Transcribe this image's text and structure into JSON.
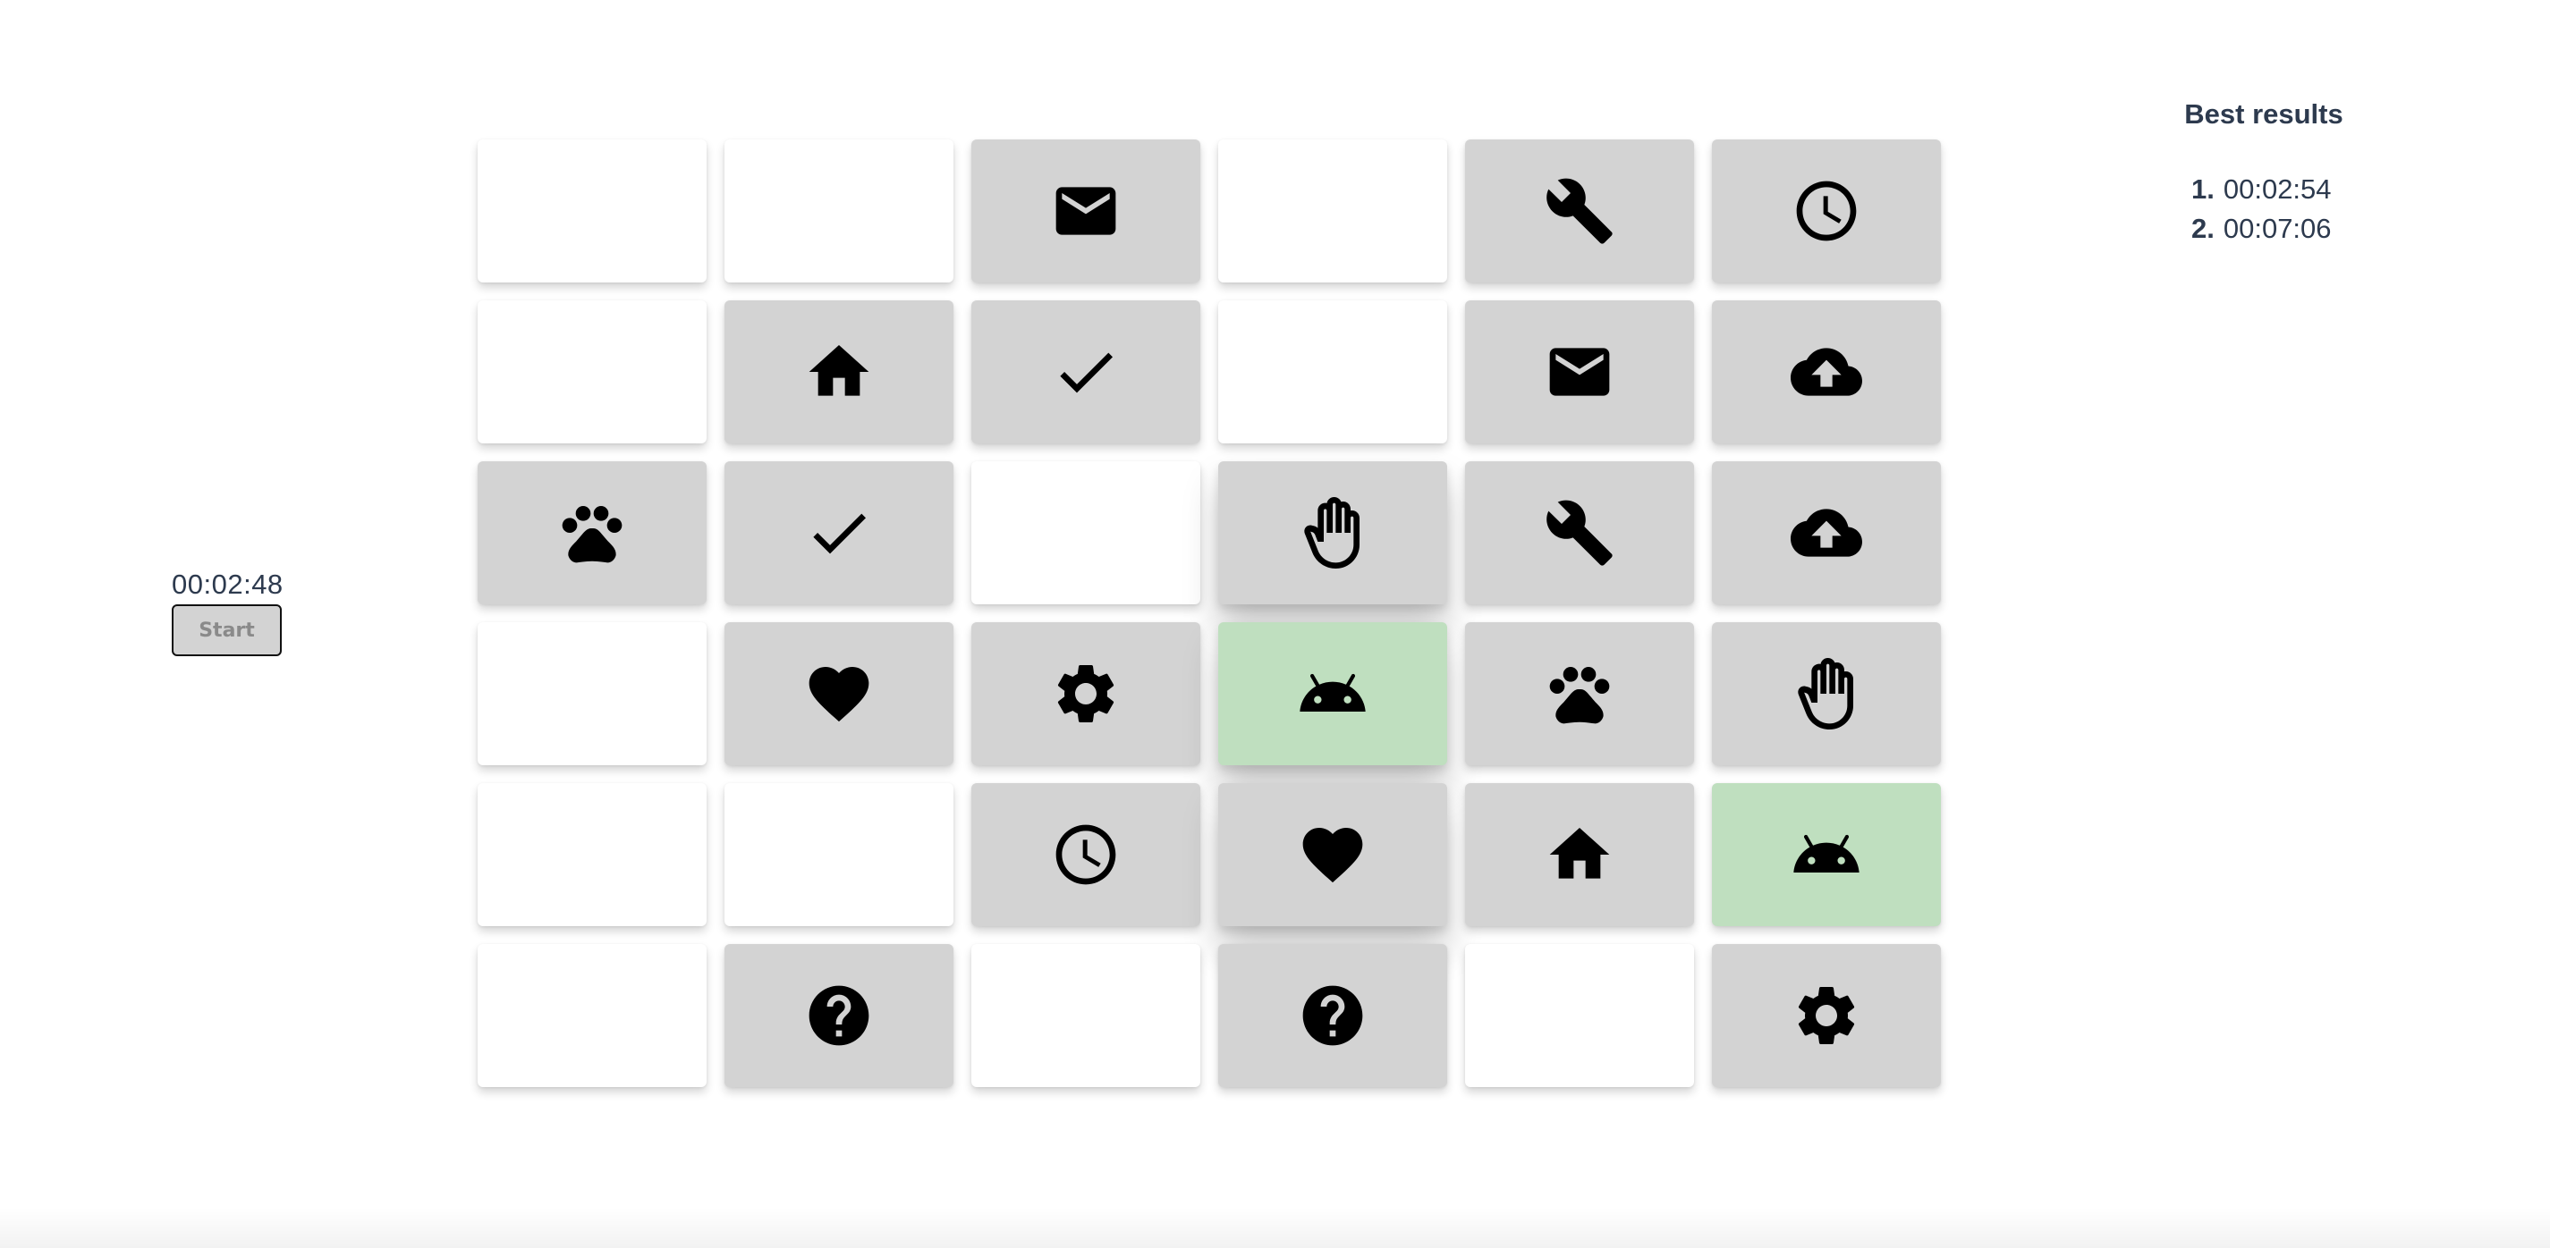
{
  "game": {
    "timer": "00:02:48",
    "start_label": "Start"
  },
  "results": {
    "title": "Best results",
    "entries": [
      {
        "rank": "1.",
        "time": "00:02:54"
      },
      {
        "rank": "2.",
        "time": "00:07:06"
      }
    ]
  },
  "colors": {
    "face_down": "#ffffff",
    "face_up": "#d3d3d3",
    "matched": "#bfdfbf",
    "text": "#2d3a4e"
  },
  "board": {
    "rows": 6,
    "cols": 6,
    "cards": [
      {
        "state": "face-down",
        "icon": null
      },
      {
        "state": "face-down",
        "icon": null
      },
      {
        "state": "face-up",
        "icon": "mail-icon"
      },
      {
        "state": "face-down",
        "icon": null
      },
      {
        "state": "face-up",
        "icon": "wrench-icon"
      },
      {
        "state": "face-up",
        "icon": "clock-icon"
      },
      {
        "state": "face-down",
        "icon": null
      },
      {
        "state": "face-up",
        "icon": "home-icon"
      },
      {
        "state": "face-up",
        "icon": "check-icon"
      },
      {
        "state": "face-down",
        "icon": null
      },
      {
        "state": "face-up",
        "icon": "mail-icon"
      },
      {
        "state": "face-up",
        "icon": "cloud-upload-icon"
      },
      {
        "state": "face-up",
        "icon": "paw-icon"
      },
      {
        "state": "face-up",
        "icon": "check-icon"
      },
      {
        "state": "face-down",
        "icon": null
      },
      {
        "state": "face-up",
        "icon": "hand-icon"
      },
      {
        "state": "face-up",
        "icon": "wrench-icon"
      },
      {
        "state": "face-up",
        "icon": "cloud-upload-icon"
      },
      {
        "state": "face-down",
        "icon": null
      },
      {
        "state": "face-up",
        "icon": "heart-icon"
      },
      {
        "state": "face-up",
        "icon": "gear-icon"
      },
      {
        "state": "matched",
        "icon": "android-icon"
      },
      {
        "state": "face-up",
        "icon": "paw-icon"
      },
      {
        "state": "face-up",
        "icon": "hand-icon"
      },
      {
        "state": "face-down",
        "icon": null
      },
      {
        "state": "face-down",
        "icon": null
      },
      {
        "state": "face-up",
        "icon": "clock-icon"
      },
      {
        "state": "face-up",
        "icon": "heart-icon"
      },
      {
        "state": "face-up",
        "icon": "home-icon"
      },
      {
        "state": "matched",
        "icon": "android-icon"
      },
      {
        "state": "face-down",
        "icon": null
      },
      {
        "state": "face-up",
        "icon": "help-icon"
      },
      {
        "state": "face-down",
        "icon": null
      },
      {
        "state": "face-up",
        "icon": "help-icon"
      },
      {
        "state": "face-down",
        "icon": null
      },
      {
        "state": "face-up",
        "icon": "gear-icon"
      }
    ]
  }
}
